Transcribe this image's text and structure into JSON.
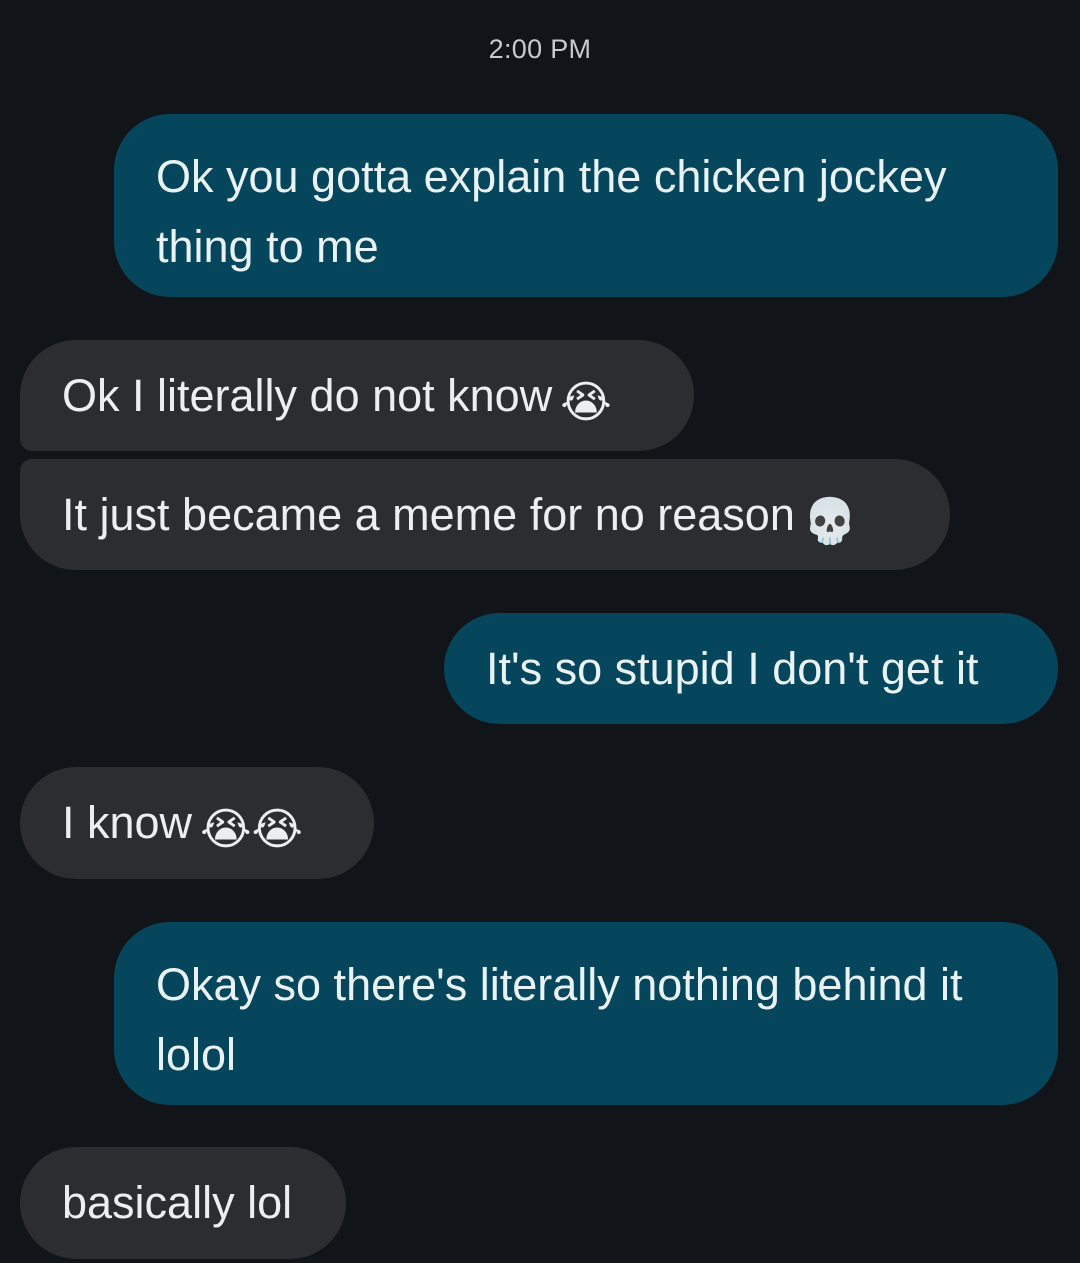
{
  "conversation": {
    "timestamp": "2:00 PM",
    "messages": [
      {
        "from": "me",
        "text": "Ok you gotta explain the chicken jockey thing to me",
        "emoji": ""
      },
      {
        "from": "them",
        "text": "Ok I literally do not know",
        "emoji": "😭"
      },
      {
        "from": "them",
        "text": "It just became a meme for no reason",
        "emoji": "💀"
      },
      {
        "from": "me",
        "text": "It's so stupid I don't get it",
        "emoji": ""
      },
      {
        "from": "them",
        "text": "I know",
        "emoji": "😭😭"
      },
      {
        "from": "me",
        "text": "Okay so there's literally nothing behind it lolol",
        "emoji": ""
      },
      {
        "from": "them",
        "text": "basically lol",
        "emoji": ""
      }
    ]
  },
  "colors": {
    "background": "#111418",
    "sent_bubble": "#05465c",
    "received_bubble": "#2b2d31"
  },
  "icons": {
    "loudly-crying-face": "😭",
    "skull": "💀"
  }
}
